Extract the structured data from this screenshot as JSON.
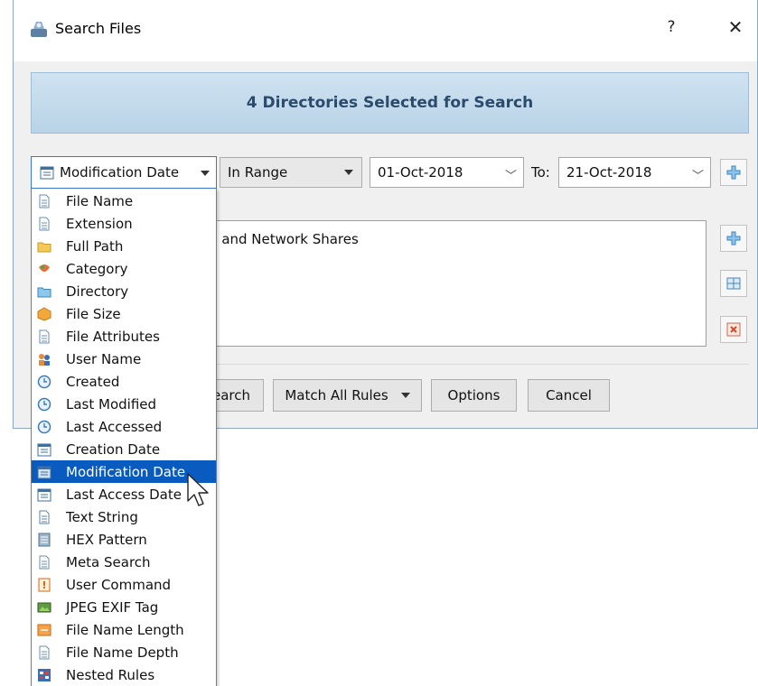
{
  "window": {
    "title": "Search Files",
    "help_label": "?",
    "close_label": "✕"
  },
  "banner": {
    "text": "4 Directories Selected for Search"
  },
  "rule": {
    "field": "Modification Date",
    "operator": "In Range",
    "from_date": "01-Oct-2018",
    "to_label": "To:",
    "to_date": "21-Oct-2018"
  },
  "list": {
    "visible_text": "ories and Network Shares"
  },
  "buttons": {
    "search_partial": "earch",
    "match_rules": "Match All Rules",
    "options": "Options",
    "cancel": "Cancel"
  },
  "dropdown": {
    "items": [
      {
        "label": "File Name",
        "icon": "file-name-icon"
      },
      {
        "label": "Extension",
        "icon": "extension-icon"
      },
      {
        "label": "Full Path",
        "icon": "folder-icon"
      },
      {
        "label": "Category",
        "icon": "category-icon"
      },
      {
        "label": "Directory",
        "icon": "directory-icon"
      },
      {
        "label": "File Size",
        "icon": "file-size-icon"
      },
      {
        "label": "File Attributes",
        "icon": "file-attributes-icon"
      },
      {
        "label": "User Name",
        "icon": "user-name-icon"
      },
      {
        "label": "Created",
        "icon": "clock-icon"
      },
      {
        "label": "Last Modified",
        "icon": "clock-icon"
      },
      {
        "label": "Last Accessed",
        "icon": "clock-icon"
      },
      {
        "label": "Creation Date",
        "icon": "calendar-icon"
      },
      {
        "label": "Modification Date",
        "icon": "calendar-icon"
      },
      {
        "label": "Last Access Date",
        "icon": "calendar-icon"
      },
      {
        "label": "Text String",
        "icon": "text-string-icon"
      },
      {
        "label": "HEX Pattern",
        "icon": "hex-pattern-icon"
      },
      {
        "label": "Meta Search",
        "icon": "meta-search-icon"
      },
      {
        "label": "User Command",
        "icon": "user-command-icon"
      },
      {
        "label": "JPEG EXIF Tag",
        "icon": "jpeg-exif-icon"
      },
      {
        "label": "File Name Length",
        "icon": "file-name-length-icon"
      },
      {
        "label": "File Name Depth",
        "icon": "file-name-depth-icon"
      },
      {
        "label": "Nested Rules",
        "icon": "nested-rules-icon"
      }
    ],
    "selected": "Modification Date"
  },
  "colors": {
    "selection": "#0a5bbf",
    "banner_text": "#2c4a6c",
    "banner_bg": "#c4dbec"
  }
}
